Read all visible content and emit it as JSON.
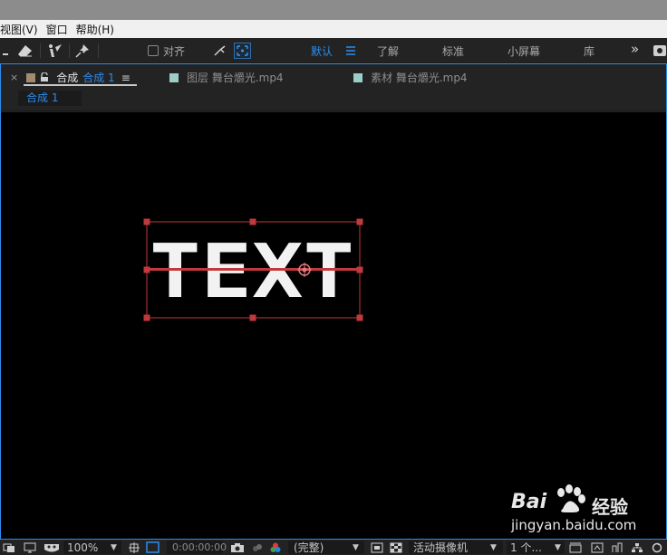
{
  "menu": {
    "items": [
      "视图(V)",
      "窗口",
      "帮助(H)"
    ]
  },
  "toolbar": {
    "align_label": "对齐",
    "workspaces": [
      "默认",
      "了解",
      "标准",
      "小屏幕",
      "库"
    ],
    "more_label": "»"
  },
  "panel": {
    "tabs": {
      "comp": {
        "close": "×",
        "prefix": "合成",
        "name": "合成 1",
        "menu": "≡",
        "color": "#a38c6e"
      },
      "layer": {
        "label": "图层 舞台爝光.mp4",
        "color": "#9ccec8"
      },
      "footage": {
        "label": "素材 舞台爝光.mp4",
        "color": "#9ccec8"
      }
    },
    "subtab": "合成 1"
  },
  "viewer": {
    "text": "TEXT",
    "bbox_color": "#c0393d"
  },
  "statusbar": {
    "zoom": "100%",
    "timecode": "0:00:00:00",
    "resolution": "(完整)",
    "camera": "活动摄像机",
    "views": "1 个..."
  },
  "watermark": {
    "brand": "Bai",
    "brand2": "经验",
    "url": "jingyan.baidu.com"
  }
}
